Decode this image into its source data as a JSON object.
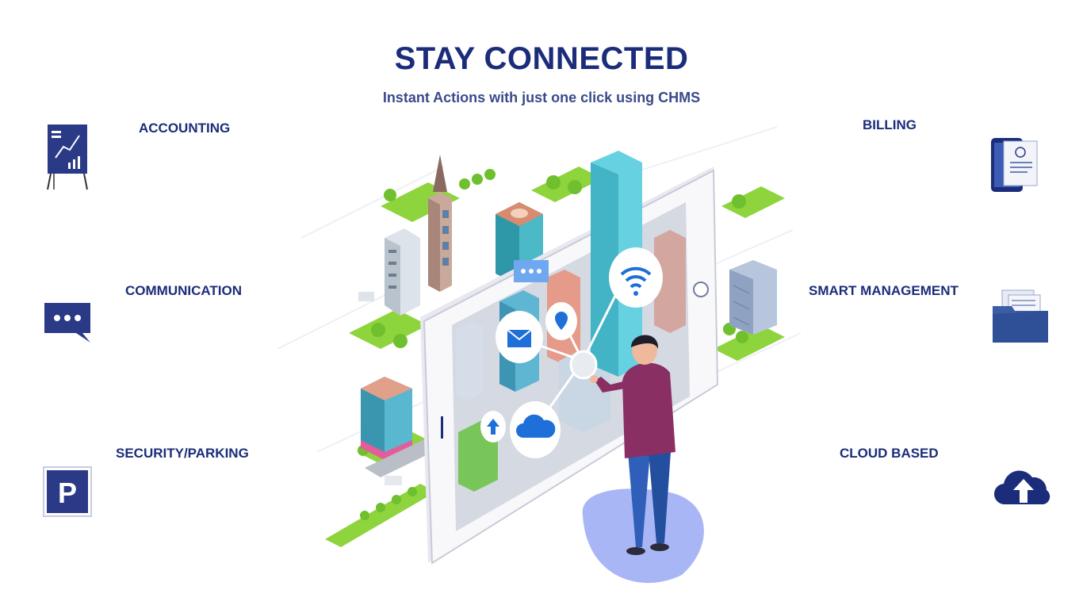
{
  "header": {
    "title": "STAY CONNECTED",
    "subtitle": "Instant Actions with just one click using CHMS"
  },
  "features": {
    "left": [
      {
        "label": "ACCOUNTING",
        "icon": "chart-board-icon"
      },
      {
        "label": "COMMUNICATION",
        "icon": "chat-bubble-icon"
      },
      {
        "label": "SECURITY/PARKING",
        "icon": "parking-sign-icon"
      }
    ],
    "right": [
      {
        "label": "BILLING",
        "icon": "invoice-phone-icon"
      },
      {
        "label": "SMART MANAGEMENT",
        "icon": "folder-icon"
      },
      {
        "label": "CLOUD BASED",
        "icon": "cloud-upload-icon"
      }
    ]
  },
  "illustration": {
    "parking_glyph": "P"
  },
  "colors": {
    "navy": "#1b2d7a",
    "icon_blue": "#2b3a87",
    "tablet": "#f4f4f8",
    "accent_blue": "#1f6fd8"
  }
}
